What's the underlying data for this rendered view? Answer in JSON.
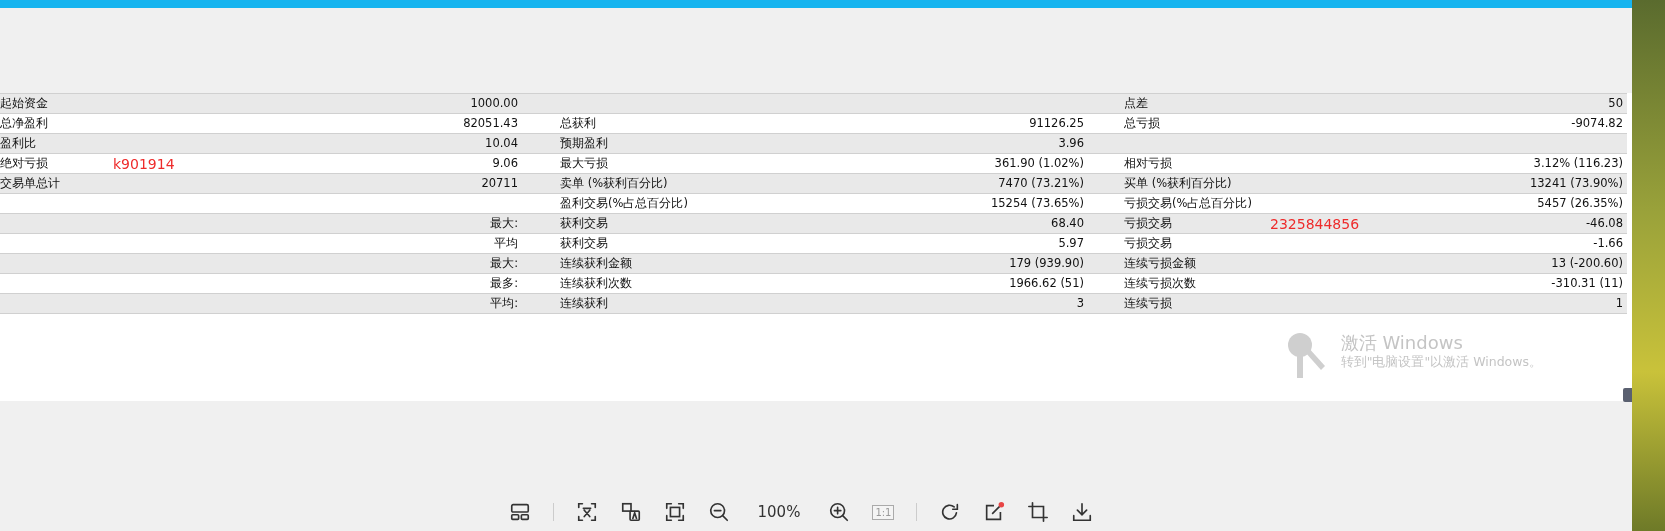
{
  "stats_table": {
    "rows": [
      {
        "label_1": "起始资金",
        "value_1": "1000.00",
        "label_3": "点差",
        "value_3": "50"
      },
      {
        "label_1": "总净盈利",
        "value_1": "82051.43",
        "label_2": "总获利",
        "value_2": "91126.25",
        "label_3": "总亏损",
        "value_3": "-9074.82"
      },
      {
        "label_1": "盈利比",
        "value_1": "10.04",
        "label_2": "预期盈利",
        "value_2": "3.96"
      },
      {
        "label_1": "绝对亏损",
        "note_1": "k901914",
        "value_1": "9.06",
        "label_2": "最大亏损",
        "value_2": "361.90 (1.02%)",
        "label_3": "相对亏损",
        "value_3": "3.12% (116.23)"
      },
      {
        "label_1": "交易单总计",
        "value_1": "20711",
        "label_2": "卖单 (%获利百分比)",
        "value_2": "7470 (73.21%)",
        "label_3": "买单 (%获利百分比)",
        "value_3": "13241 (73.90%)"
      },
      {
        "label_2": "盈利交易(%占总百分比)",
        "value_2": "15254 (73.65%)",
        "label_3": "亏损交易(%占总百分比)",
        "value_3": "5457 (26.35%)"
      },
      {
        "value_1": "最大:",
        "label_2": "获利交易",
        "value_2": "68.40",
        "label_3": "亏损交易",
        "note_3": "2325844856",
        "value_3": "-46.08"
      },
      {
        "value_1": "平均",
        "label_2": "获利交易",
        "value_2": "5.97",
        "label_3": "亏损交易",
        "value_3": "-1.66"
      },
      {
        "value_1": "最大:",
        "label_2": "连续获利金额",
        "value_2": "179 (939.90)",
        "label_3": "连续亏损金额",
        "value_3": "13 (-200.60)"
      },
      {
        "value_1": "最多:",
        "label_2": "连续获利次数",
        "value_2": "1966.62 (51)",
        "label_3": "连续亏损次数",
        "value_3": "-310.31 (11)"
      },
      {
        "value_1": "平均:",
        "label_2": "连续获利",
        "value_2": "3",
        "label_3": "连续亏损",
        "value_3": "1"
      }
    ]
  },
  "activation_notice": {
    "title": "激活 Windows",
    "subtitle": "转到\"电脑设置\"以激活 Windows。"
  },
  "toolbar": {
    "zoom": "100%",
    "actual_size": {
      "label": "1:1",
      "disabled": true
    }
  }
}
